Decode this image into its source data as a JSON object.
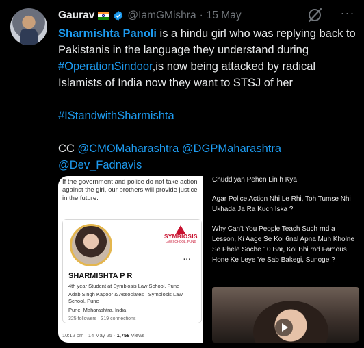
{
  "tweet": {
    "author_name": "Gaurav",
    "handle": "@IamGMishra",
    "separator": "·",
    "date": "15 May",
    "text": {
      "mention_name": "Sharmishta Panoli",
      "part1": " is a hindu girl who was replying back to Pakistanis in the language they understand during ",
      "hashtag1": "#OperationSindoor",
      "part2": ",is now being attacked by radical Islamists of India now they want to STSJ of her",
      "hashtag2": "#IStandwithSharmishta",
      "cc_label": "CC ",
      "cc1": "@CMOMaharashtra",
      "cc2": "@DGPMaharashtra",
      "cc3": "@Dev_Fadnavis"
    }
  },
  "media": {
    "left": {
      "warning": "If the government and police do not take action against the girl, our brothers will provide justice in the future.",
      "logo_name": "SYMBIOSIS",
      "logo_sub": "LAW SCHOOL, PUNE",
      "profile_name": "SHARMISHTA P R",
      "headline": "4th year Student at Symbiosis Law School, Pune",
      "org": "Adab Singh Kapoor & Associates · Symbiosis Law School, Pune",
      "location": "Pune, Maharashtra, India",
      "stats": "325 followers · 319 connections",
      "meta_time": "10:12 pm · 14 May 25 · ",
      "meta_views": "1,758",
      "meta_views_label": " Views"
    },
    "right": {
      "line1": "Chuddiyan Pehen Lin h Kya",
      "line2": "Agar Police Action Nhi Le Rhi, Toh Tumse Nhi Ukhada Ja Ra Kuch Iska ?",
      "line3": "Why Can't You People Teach Such rnd a Lesson, Ki Aage Se Koi 6nal Apna Muh Kholne Se Phele Soche 10 Bar, Koi Bhi rnd Famous Hone Ke Leye Ye Sab Bakegi, Sunoge ?"
    }
  },
  "colors": {
    "link": "#1d9bf0",
    "muted": "#71767b",
    "text": "#e7e9ea"
  },
  "icons": [
    "verified-badge-icon",
    "grok-icon",
    "more-icon",
    "play-icon"
  ]
}
